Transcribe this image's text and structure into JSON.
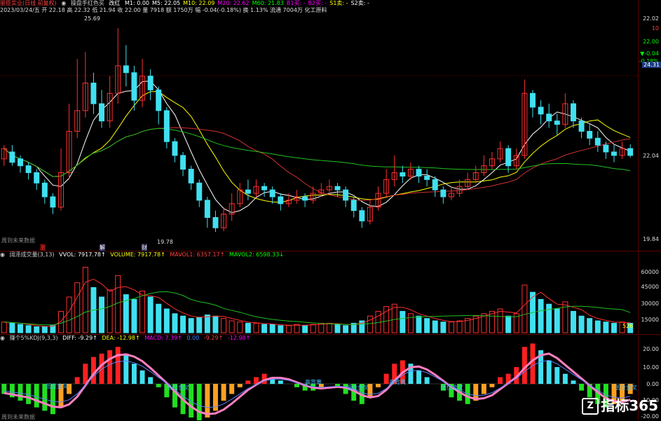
{
  "main_header": {
    "stock": "丽臣实业(日线 前复权)",
    "indicator": "操盘手红色买",
    "item_red": "改红",
    "values": [
      {
        "label": "M1: 0.00",
        "color": "#ffffff"
      },
      {
        "label": "M5: 22.05",
        "color": "#ffffff"
      },
      {
        "label": "M10: 22.09",
        "color": "#ffff00"
      },
      {
        "label": "M20: 22.62",
        "color": "#ff00ff"
      },
      {
        "label": "M60: 21.83",
        "color": "#00ff00"
      },
      {
        "label": "B1买: -",
        "color": "#ff00ff"
      },
      {
        "label": "B2买: -",
        "color": "#ff00ff"
      },
      {
        "label": "S1卖: -",
        "color": "#ffff00"
      },
      {
        "label": "S2卖: -",
        "color": "#ffffff"
      }
    ],
    "line2": "2023/03/24/五  开 22.18 高 22.32 低 21.94 收 22.00 量 7918 额 1750万 幅 -0.04(-0.18%) 换 1.13% 流通 7004万 化工原料"
  },
  "main_axis": {
    "ticks": [
      "22.02",
      "10",
      "22.00",
      "▼-0.04",
      "-0.18%",
      "22.04",
      "19.84"
    ],
    "price_box": "24.31"
  },
  "main_annotations": {
    "high_label": "25.69",
    "low_label": "19.78",
    "footer": "周到未来数据",
    "events": [
      "涨",
      "解",
      "财"
    ]
  },
  "volume_header": {
    "title": "阔泽成交量(3,13)",
    "vvol": "VVOL: 7917.78↑",
    "volume": "VOLUME: 7917.78↑",
    "mavol1": "MAVOL1: 6357.17↑",
    "mavol2": "MAVOL2: 6598.33↓"
  },
  "volume_axis": {
    "ticks": [
      "60000",
      "45000",
      "30000",
      "15000"
    ],
    "last": "526"
  },
  "macd_header": {
    "title": "赚个5%KDJ(9,3,3)",
    "diff": "DIFF: -9.29↑",
    "dea": "DEA: -12.98↑",
    "macd": "MACD: 7.39↑",
    "v1": "0.00",
    "v2": "-9.29↑",
    "v3": "-12.98↑"
  },
  "macd_axis": {
    "ticks": [
      "20.00",
      "10.00",
      "0.00",
      "-10.00",
      "-20.00"
    ]
  },
  "macd_tags": [
    "低位金叉",
    "低位金叉",
    "高背离",
    "低位金叉",
    "高背离",
    "低位金叉",
    "低位金叉"
  ],
  "macd_footer": "周到未来数据",
  "logo": {
    "text": "指标365",
    "box": "Z"
  },
  "chart_data": {
    "type": "candlestick",
    "candles": [
      [
        21.9,
        22.2,
        21.7,
        22.3
      ],
      [
        22.1,
        21.8,
        21.7,
        22.3
      ],
      [
        21.9,
        21.7,
        21.5,
        22.0
      ],
      [
        21.7,
        21.5,
        21.3,
        21.8
      ],
      [
        21.5,
        21.2,
        21.0,
        21.6
      ],
      [
        21.2,
        20.8,
        20.6,
        21.3
      ],
      [
        20.8,
        20.5,
        20.3,
        20.9
      ],
      [
        20.5,
        21.5,
        20.4,
        22.2
      ],
      [
        21.5,
        22.7,
        21.3,
        23.5
      ],
      [
        22.7,
        23.3,
        22.5,
        24.8
      ],
      [
        23.3,
        24.1,
        23.1,
        25.0
      ],
      [
        24.1,
        23.5,
        23.2,
        24.4
      ],
      [
        23.5,
        23.0,
        22.8,
        23.9
      ],
      [
        23.0,
        23.8,
        22.8,
        24.3
      ],
      [
        23.8,
        24.6,
        23.5,
        25.69
      ],
      [
        24.6,
        24.4,
        24.0,
        25.2
      ],
      [
        24.4,
        23.6,
        23.3,
        24.6
      ],
      [
        23.6,
        24.3,
        23.4,
        24.8
      ],
      [
        24.3,
        23.9,
        23.6,
        24.5
      ],
      [
        23.9,
        23.3,
        22.9,
        24.0
      ],
      [
        23.3,
        22.4,
        22.2,
        23.4
      ],
      [
        22.4,
        22.0,
        21.8,
        22.5
      ],
      [
        22.0,
        21.6,
        21.4,
        22.1
      ],
      [
        21.6,
        21.2,
        21.0,
        21.7
      ],
      [
        21.2,
        20.7,
        20.5,
        21.3
      ],
      [
        20.7,
        20.2,
        19.9,
        20.8
      ],
      [
        20.2,
        19.9,
        19.78,
        20.4
      ],
      [
        19.9,
        20.3,
        19.8,
        20.5
      ],
      [
        20.3,
        20.6,
        20.1,
        20.9
      ],
      [
        20.6,
        21.0,
        20.5,
        21.2
      ],
      [
        21.0,
        20.9,
        20.7,
        21.3
      ],
      [
        20.9,
        21.1,
        20.8,
        21.3
      ],
      [
        21.1,
        21.0,
        20.8,
        21.2
      ],
      [
        21.0,
        20.8,
        20.6,
        21.1
      ],
      [
        20.8,
        20.6,
        20.4,
        20.9
      ],
      [
        20.6,
        20.7,
        20.5,
        20.9
      ],
      [
        20.7,
        20.8,
        20.6,
        21.0
      ],
      [
        20.8,
        20.7,
        20.5,
        20.9
      ],
      [
        20.7,
        20.9,
        20.6,
        21.1
      ],
      [
        20.9,
        21.0,
        20.8,
        21.2
      ],
      [
        21.0,
        21.1,
        20.9,
        21.3
      ],
      [
        21.1,
        21.0,
        20.8,
        21.2
      ],
      [
        21.0,
        20.7,
        20.5,
        21.1
      ],
      [
        20.7,
        20.4,
        20.2,
        20.8
      ],
      [
        20.4,
        20.1,
        19.9,
        20.5
      ],
      [
        20.1,
        20.5,
        20.0,
        20.7
      ],
      [
        20.5,
        20.9,
        20.4,
        21.1
      ],
      [
        20.9,
        21.3,
        20.8,
        21.6
      ],
      [
        21.3,
        21.5,
        21.1,
        22.0
      ],
      [
        21.5,
        21.4,
        21.2,
        21.7
      ],
      [
        21.4,
        21.6,
        21.3,
        21.8
      ],
      [
        21.6,
        21.4,
        21.2,
        21.7
      ],
      [
        21.4,
        21.3,
        21.1,
        21.6
      ],
      [
        21.3,
        21.0,
        20.8,
        21.4
      ],
      [
        21.0,
        20.8,
        20.6,
        21.1
      ],
      [
        20.8,
        20.9,
        20.7,
        21.1
      ],
      [
        20.9,
        21.1,
        20.8,
        21.3
      ],
      [
        21.1,
        21.3,
        21.0,
        21.5
      ],
      [
        21.3,
        21.5,
        21.2,
        21.7
      ],
      [
        21.5,
        21.7,
        21.4,
        22.0
      ],
      [
        21.7,
        21.9,
        21.6,
        22.1
      ],
      [
        21.9,
        22.2,
        21.8,
        22.4
      ],
      [
        22.2,
        21.7,
        21.5,
        22.3
      ],
      [
        21.7,
        22.0,
        21.6,
        22.2
      ],
      [
        22.0,
        23.8,
        21.9,
        24.2
      ],
      [
        23.8,
        23.4,
        23.1,
        23.9
      ],
      [
        23.4,
        23.2,
        22.9,
        23.6
      ],
      [
        23.2,
        23.0,
        22.8,
        23.5
      ],
      [
        23.0,
        22.9,
        22.6,
        23.2
      ],
      [
        22.9,
        23.5,
        22.8,
        23.8
      ],
      [
        23.5,
        23.0,
        22.8,
        23.6
      ],
      [
        23.0,
        22.7,
        22.5,
        23.1
      ],
      [
        22.7,
        22.5,
        22.3,
        22.9
      ],
      [
        22.5,
        22.3,
        22.1,
        22.7
      ],
      [
        22.3,
        22.1,
        21.9,
        22.4
      ],
      [
        22.1,
        22.0,
        21.8,
        22.3
      ],
      [
        22.0,
        22.2,
        21.9,
        22.4
      ],
      [
        22.2,
        22.0,
        21.94,
        22.32
      ]
    ],
    "volumes": [
      9,
      8,
      7,
      6,
      5,
      5,
      6,
      18,
      30,
      42,
      55,
      38,
      30,
      36,
      48,
      32,
      28,
      35,
      30,
      24,
      20,
      16,
      14,
      12,
      13,
      15,
      14,
      12,
      10,
      9,
      8,
      8,
      7,
      7,
      6,
      6,
      7,
      6,
      7,
      8,
      8,
      7,
      6,
      8,
      10,
      14,
      18,
      22,
      24,
      18,
      16,
      14,
      12,
      10,
      9,
      9,
      10,
      12,
      14,
      16,
      18,
      20,
      14,
      16,
      40,
      34,
      28,
      24,
      20,
      26,
      18,
      14,
      12,
      10,
      9,
      8,
      9,
      8
    ],
    "macd": [
      -6,
      -8,
      -10,
      -12,
      -14,
      -16,
      -18,
      -14,
      -6,
      4,
      12,
      16,
      18,
      20,
      22,
      18,
      12,
      8,
      4,
      -2,
      -8,
      -14,
      -18,
      -20,
      -22,
      -20,
      -16,
      -10,
      -6,
      -2,
      2,
      4,
      6,
      4,
      2,
      0,
      -2,
      -4,
      -4,
      -2,
      0,
      -2,
      -6,
      -10,
      -12,
      -8,
      -2,
      6,
      12,
      14,
      12,
      8,
      4,
      0,
      -4,
      -8,
      -10,
      -12,
      -10,
      -6,
      -2,
      4,
      6,
      10,
      22,
      24,
      20,
      14,
      10,
      6,
      2,
      -4,
      -8,
      -12,
      -14,
      -12,
      -10,
      -6
    ]
  }
}
